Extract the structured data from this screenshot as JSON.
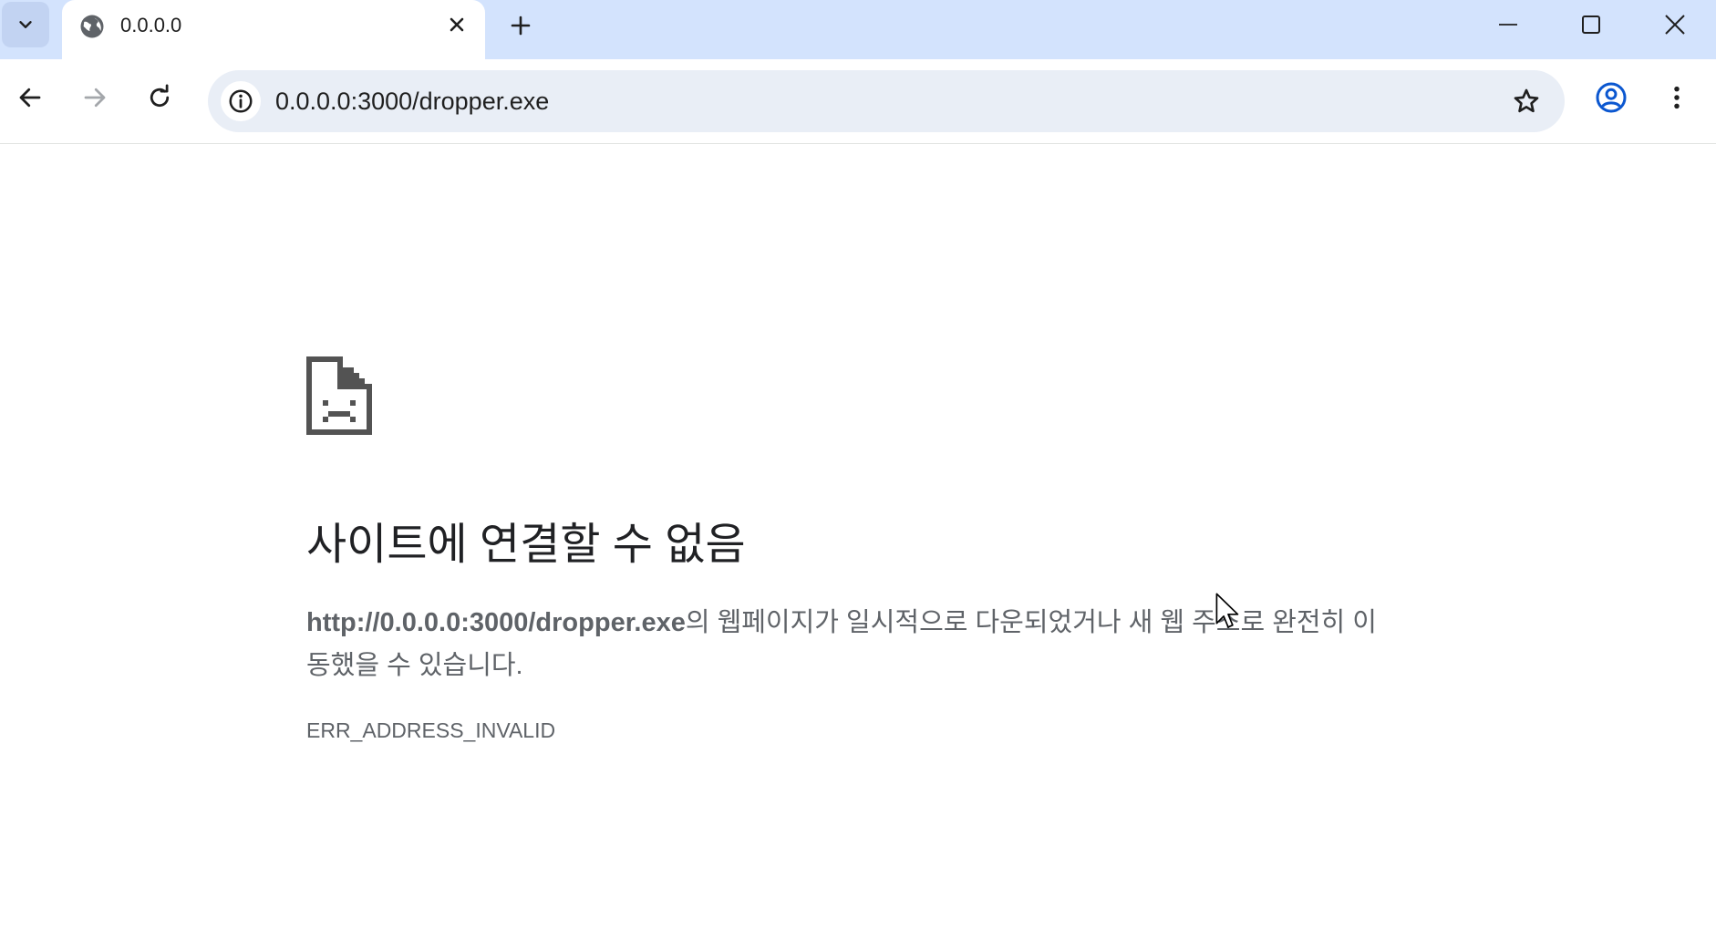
{
  "browser": {
    "tab": {
      "title": "0.0.0.0",
      "favicon": "globe-icon"
    },
    "address_bar": {
      "url": "0.0.0.0:3000/dropper.exe"
    },
    "icons": {
      "tab_search": "chevron-down-icon",
      "tab_close": "close-icon",
      "new_tab": "plus-icon",
      "minimize": "minimize-icon",
      "maximize": "maximize-icon",
      "window_close": "close-icon",
      "back": "back-arrow-icon",
      "forward": "forward-arrow-icon",
      "reload": "reload-icon",
      "site_info": "info-icon",
      "bookmark": "star-icon",
      "profile": "profile-icon",
      "menu": "more-vert-icon"
    },
    "colors": {
      "titlebar": "#d3e3fd",
      "omnibox": "#e9eef6",
      "profile": "#0b57d0"
    }
  },
  "error_page": {
    "icon": "sad-page-icon",
    "heading": "사이트에 연결할 수 없음",
    "url_bold": "http://0.0.0.0:3000/dropper.exe",
    "description_rest": "의 웹페이지가 일시적으로 다운되었거나 새 웹 주소로 완전히 이동했을 수 있습니다.",
    "error_code": "ERR_ADDRESS_INVALID"
  }
}
